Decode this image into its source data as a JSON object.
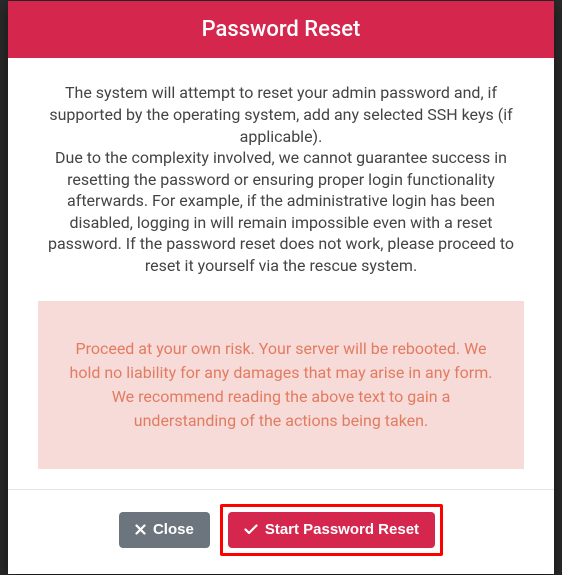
{
  "modal": {
    "title": "Password Reset",
    "body": {
      "paragraph1": "The system will attempt to reset your admin password and, if supported by the operating system, add any selected SSH keys (if applicable).",
      "paragraph2": "Due to the complexity involved, we cannot guarantee success in resetting the password or ensuring proper login functionality afterwards. For example, if the administrative login has been disabled, logging in will remain impossible even with a reset password. If the password reset does not work, please proceed to reset it yourself via the rescue system."
    },
    "warning": "Proceed at your own risk. Your server will be rebooted. We hold no liability for any damages that may arise in any form. We recommend reading the above text to gain a understanding of the actions being taken.",
    "footer": {
      "close_label": "Close",
      "confirm_label": "Start Password Reset"
    }
  }
}
